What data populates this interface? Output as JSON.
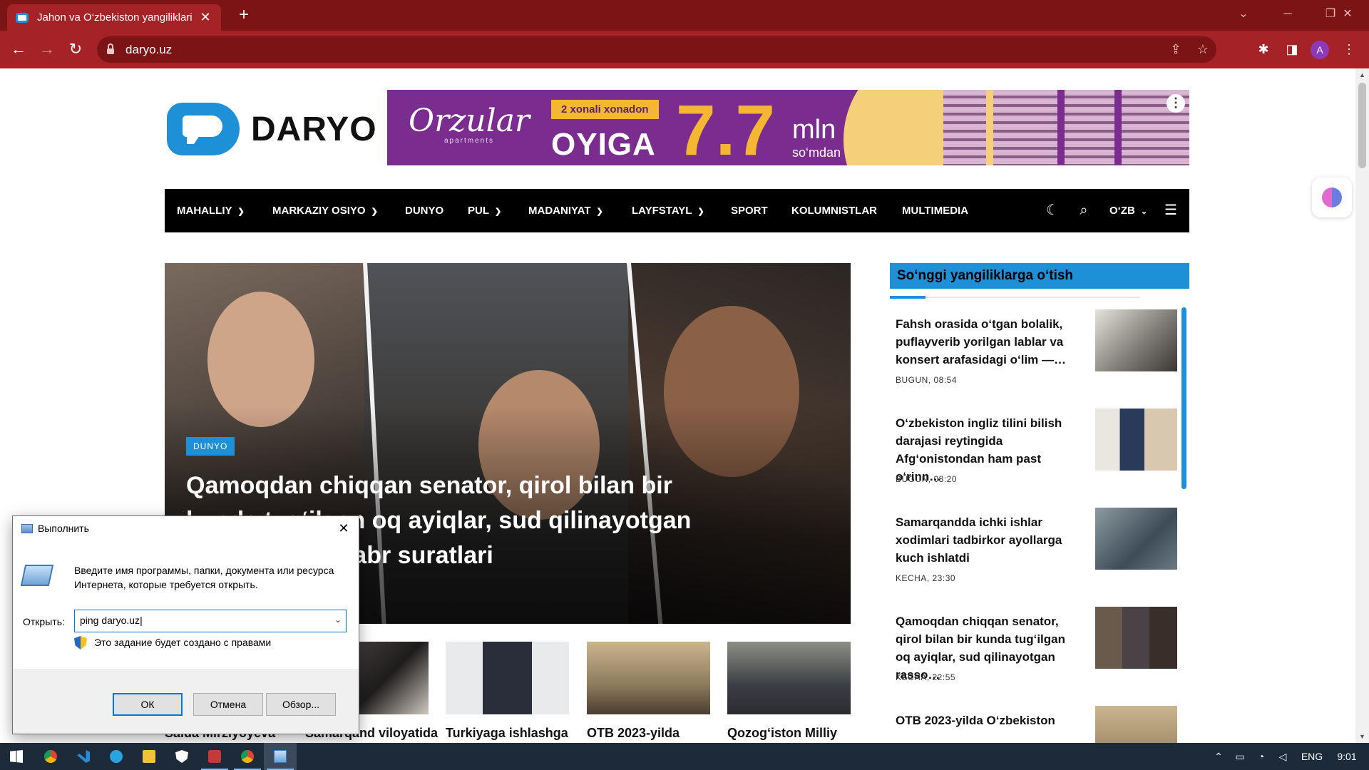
{
  "browser": {
    "tab_title": "Jahon va O‘zbekiston yangiliklari",
    "tab_close": "✕",
    "new_tab": "+",
    "url": "daryo.uz",
    "avatar_letter": "A",
    "tab_color": "#a52326",
    "frame_color": "#7c1315"
  },
  "site": {
    "logo_text": "DARYO",
    "brand_color": "#1e90d8"
  },
  "banner": {
    "brand": "Orzular",
    "brand_sub": "apartments",
    "pill": "2 xonali xonadon",
    "headline": "OYIGA",
    "number": "7.7",
    "unit": "mln",
    "unit_sub": "so‘mdan"
  },
  "nav": {
    "items": [
      {
        "label": "MAHALLIY",
        "dropdown": true
      },
      {
        "label": "MARKAZIY OSIYO",
        "dropdown": true
      },
      {
        "label": "DUNYO",
        "dropdown": false
      },
      {
        "label": "PUL",
        "dropdown": true
      },
      {
        "label": "MADANIYAT",
        "dropdown": true
      },
      {
        "label": "LAYFSTAYL",
        "dropdown": true
      },
      {
        "label": "SPORT",
        "dropdown": false
      },
      {
        "label": "KOLUMNISTLAR",
        "dropdown": false
      },
      {
        "label": "MULTIMEDIA",
        "dropdown": false
      }
    ],
    "language": "O‘ZB",
    "icons": [
      "moon-icon",
      "search-icon",
      "menu-icon"
    ]
  },
  "hero": {
    "category": "DUNYO",
    "title": "Qamoqdan chiqqan senator, qirol bilan bir kunda tug‘ilgan oq ayiqlar, sud qilinayotgan rassom — noyabr suratlari"
  },
  "thumbs": [
    {
      "title": "Saida Mirziyoyeva"
    },
    {
      "title": "Samarqand viloyatida"
    },
    {
      "title": "Turkiyaga ishlashga"
    },
    {
      "title": "OTB 2023-yilda"
    },
    {
      "title": "Qozog‘iston Milliy"
    }
  ],
  "sidebar": {
    "heading": "So‘nggi yangiliklarga o‘tish",
    "items": [
      {
        "title": "Fahsh orasida o‘tgan bolalik, puflayverib yorilgan lablar va konsert arafasidagi o‘lim —…",
        "time": "BUGUN, 08:54"
      },
      {
        "title": "O‘zbekiston ingliz tilini bilish darajasi reytingida Afg‘onistondan ham past o‘rinn…",
        "time": "BUGUN, 08:20"
      },
      {
        "title": "Samarqandda ichki ishlar xodimlari tadbirkor ayollarga kuch ishlatdi",
        "time": "KECHA, 23:30"
      },
      {
        "title": "Qamoqdan chiqqan senator, qirol bilan bir kunda tug‘ilgan oq ayiqlar, sud qilinayotgan rasso…",
        "time": "KECHA, 22:55"
      },
      {
        "title": "OTB 2023-yilda O‘zbekiston",
        "time": ""
      }
    ]
  },
  "run_dialog": {
    "title": "Выполнить",
    "description": "Введите имя программы, папки, документа или ресурса Интернета, которые требуется открыть.",
    "open_label": "Открыть:",
    "input_value": "ping daryo.uz",
    "admin_note": "Это задание будет создано с правами",
    "ok": "ОК",
    "cancel": "Отмена",
    "browse": "Обзор..."
  },
  "taskbar": {
    "apps": [
      "start-icon",
      "chrome-icon",
      "vscode-icon",
      "telegram-icon",
      "file-explorer-icon",
      "security-icon",
      "app-icon",
      "chrome-profile-icon",
      "run-icon"
    ],
    "language": "ENG",
    "time": "9:01"
  }
}
